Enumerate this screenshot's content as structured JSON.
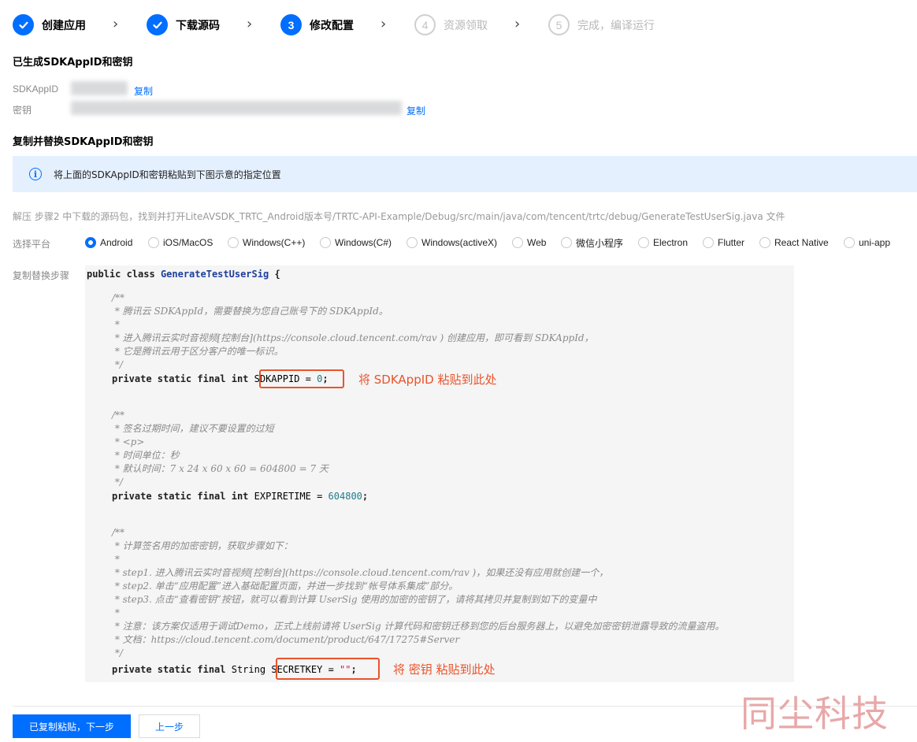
{
  "steps": [
    {
      "label": "创建应用",
      "status": "done",
      "icon": "check-icon"
    },
    {
      "label": "下载源码",
      "status": "done",
      "icon": "check-icon"
    },
    {
      "label": "修改配置",
      "status": "active",
      "number": "3"
    },
    {
      "label": "资源领取",
      "status": "todo",
      "number": "4"
    },
    {
      "label": "完成，编译运行",
      "status": "todo",
      "number": "5"
    }
  ],
  "generated": {
    "title": "已生成SDKAppID和密钥",
    "appid_label": "SDKAppID",
    "key_label": "密钥",
    "copy_label": "复制"
  },
  "replace_section": {
    "title": "复制并替换SDKAppID和密钥",
    "notice": "将上面的SDKAppID和密钥粘贴到下图示意的指定位置",
    "path_text": "解压 步骤2 中下载的源码包，找到并打开LiteAVSDK_TRTC_Android版本号/TRTC-API-Example/Debug/src/main/java/com/tencent/trtc/debug/GenerateTestUserSig.java 文件"
  },
  "platform": {
    "label": "选择平台",
    "selected": "Android",
    "options": [
      "Android",
      "iOS/MacOS",
      "Windows(C++)",
      "Windows(C#)",
      "Windows(activeX)",
      "Web",
      "微信小程序",
      "Electron",
      "Flutter",
      "React Native",
      "uni-app"
    ]
  },
  "steps_label": "复制替换步骤",
  "code": {
    "class_kw": "public class",
    "class_name": "GenerateTestUserSig",
    "class_brace": "{",
    "block1_comment": [
      "/**",
      " * 腾讯云 SDKAppId，需要替换为您自己账号下的 SDKAppId。",
      " *",
      " * 进入腾讯云实时音视频[控制台](https://console.cloud.tencent.com/rav ) 创建应用，即可看到 SDKAppId，",
      " * 它是腾讯云用于区分客户的唯一标识。",
      " */"
    ],
    "line1_kw": "private static final int",
    "line1_var": "SDKAPPID = ",
    "line1_val": "0",
    "line1_end": ";",
    "hint1": "将 SDKAppID 粘贴到此处",
    "block2_comment": [
      "/**",
      " * 签名过期时间，建议不要设置的过短",
      " * <p>",
      " * 时间单位：秒",
      " * 默认时间：7 x 24 x 60 x 60 = 604800 = 7 天",
      " */"
    ],
    "line2_kw": "private static final int",
    "line2_var": "EXPIRETIME = ",
    "line2_val": "604800",
    "line2_end": ";",
    "block3_comment": [
      "/**",
      " * 计算签名用的加密密钥，获取步骤如下：",
      " *",
      " * step1. 进入腾讯云实时音视频[控制台](https://console.cloud.tencent.com/rav )，如果还没有应用就创建一个，",
      " * step2. 单击“应用配置”进入基础配置页面，并进一步找到“帐号体系集成”部分。",
      " * step3. 点击“查看密钥”按钮，就可以看到计算 UserSig 使用的加密的密钥了，请将其拷贝并复制到如下的变量中",
      " *",
      " * 注意：该方案仅适用于调试Demo，正式上线前请将 UserSig 计算代码和密钥迁移到您的后台服务器上，以避免加密密钥泄露导致的流量盗用。",
      " * 文档：https://cloud.tencent.com/document/product/647/17275#Server",
      " */"
    ],
    "line3_kw": "private static final",
    "line3_type": "String",
    "line3_var": "SECRETKEY = ",
    "line3_val": "\"\"",
    "line3_end": ";",
    "hint3": "将 密钥 粘贴到此处"
  },
  "buttons": {
    "next": "已复制粘贴，下一步",
    "prev": "上一步"
  },
  "watermark": "同尘科技",
  "colors": {
    "accent": "#006eff",
    "highlight": "#e9542c",
    "notice_bg": "#e5f0ff"
  }
}
